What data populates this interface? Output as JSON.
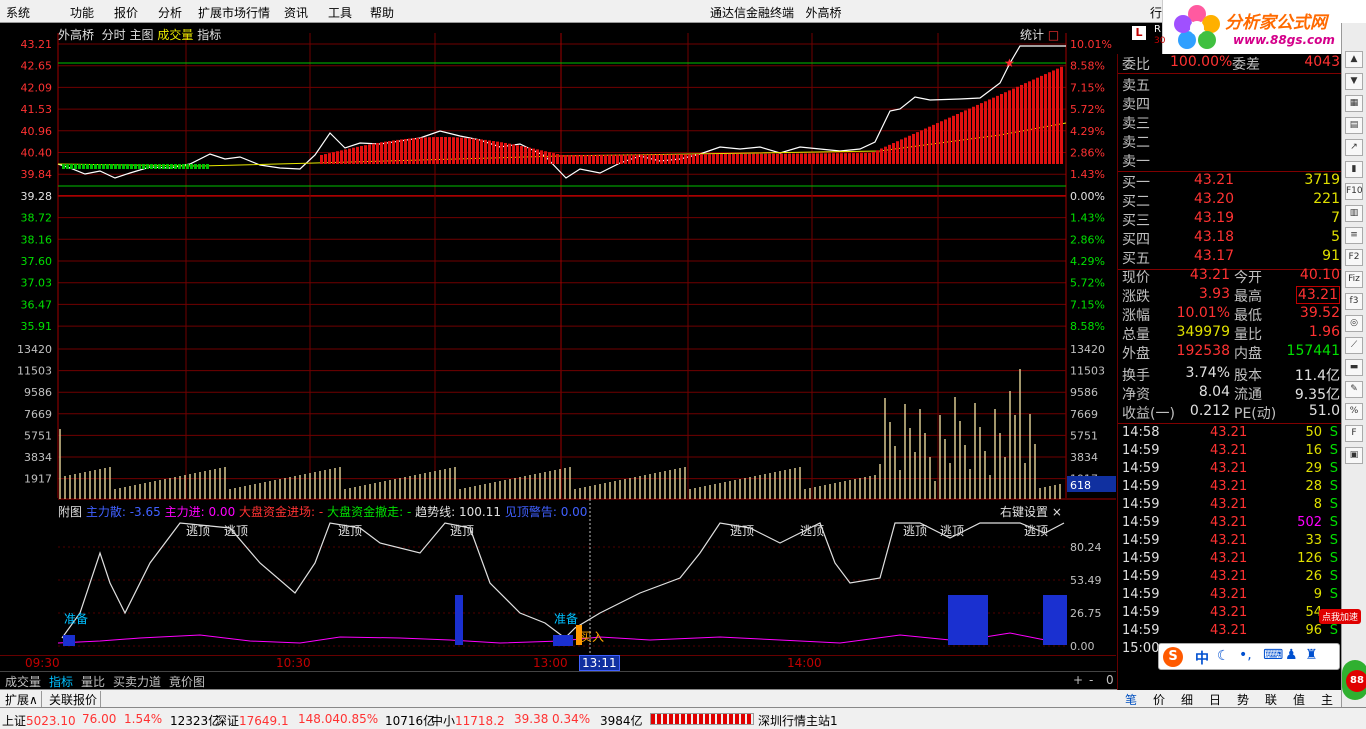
{
  "menu": {
    "items": [
      "系统",
      "功能",
      "报价",
      "分析",
      "扩展市场行情",
      "资讯",
      "工具",
      "帮助"
    ],
    "title": "通达信金融终端",
    "stock": "外高桥",
    "right_cut": "行"
  },
  "logo": {
    "line1": "分析家公式网",
    "line2": "www.88gs.com"
  },
  "chart_header": {
    "stock": "外高桥",
    "labels": [
      "分时",
      "主图",
      "成交量",
      "指标"
    ],
    "stat": "统计"
  },
  "price_axis": {
    "left": [
      "43.21",
      "42.65",
      "42.09",
      "41.53",
      "40.96",
      "40.40",
      "39.84",
      "39.28",
      "38.72",
      "38.16",
      "37.60",
      "37.03",
      "36.47",
      "35.91"
    ],
    "right": [
      "10.01%",
      "8.58%",
      "7.15%",
      "5.72%",
      "4.29%",
      "2.86%",
      "1.43%",
      "0.00%",
      "1.43%",
      "2.86%",
      "4.29%",
      "5.72%",
      "7.15%",
      "8.58%"
    ]
  },
  "vol_axis": {
    "labels": [
      "13420",
      "11503",
      "9586",
      "7669",
      "5751",
      "3834",
      "1917"
    ],
    "badge": "618"
  },
  "indicator": {
    "title": "附图",
    "legend": [
      {
        "text": "主力散",
        "value": "-3.65",
        "color": "#4060ff"
      },
      {
        "text": "主力进",
        "value": "0.00",
        "color": "#ff00ff"
      },
      {
        "text": "大盘资金进场",
        "value": "-",
        "color": "#ff3232"
      },
      {
        "text": "大盘资金撤走",
        "value": "-",
        "color": "#00e000"
      },
      {
        "text": "趋势线",
        "value": "100.11",
        "color": "#e0e0e0"
      },
      {
        "text": "见顶警告",
        "value": "0.00",
        "color": "#4060ff"
      }
    ],
    "setting": "右键设置",
    "close": "×",
    "axis": [
      "80.24",
      "53.49",
      "26.75",
      "0.00"
    ],
    "tags": {
      "top": "逃顶",
      "ready": "准备",
      "buy": "买入"
    }
  },
  "time_axis": {
    "labels": [
      "09:30",
      "10:30",
      "13:00",
      "13:11",
      "14:00"
    ]
  },
  "quote_panel": {
    "top": {
      "L": "L",
      "R": "R",
      "n": "30"
    },
    "ratio": {
      "label": "委比",
      "value": "100.00%",
      "label2": "委差",
      "value2": "4043"
    },
    "sells": [
      {
        "label": "卖五"
      },
      {
        "label": "卖四"
      },
      {
        "label": "卖三"
      },
      {
        "label": "卖二"
      },
      {
        "label": "卖一"
      }
    ],
    "buys": [
      {
        "label": "买一",
        "price": "43.21",
        "vol": "3719"
      },
      {
        "label": "买二",
        "price": "43.20",
        "vol": "221"
      },
      {
        "label": "买三",
        "price": "43.19",
        "vol": "7"
      },
      {
        "label": "买四",
        "price": "43.18",
        "vol": "5"
      },
      {
        "label": "买五",
        "price": "43.17",
        "vol": "91"
      }
    ],
    "stats": [
      {
        "l1": "现价",
        "v1": "43.21",
        "l2": "今开",
        "v2": "40.10"
      },
      {
        "l1": "涨跌",
        "v1": "3.93",
        "l2": "最高",
        "v2": "43.21"
      },
      {
        "l1": "涨幅",
        "v1": "10.01%",
        "l2": "最低",
        "v2": "39.52"
      },
      {
        "l1": "总量",
        "v1": "349979",
        "l2": "量比",
        "v2": "1.96"
      },
      {
        "l1": "外盘",
        "v1": "192538",
        "l2": "内盘",
        "v2": "157441"
      },
      {
        "l1": "换手",
        "v1": "3.74%",
        "l2": "股本",
        "v2": "11.4亿"
      },
      {
        "l1": "净资",
        "v1": "8.04",
        "l2": "流通",
        "v2": "9.35亿"
      },
      {
        "l1": "收益(一)",
        "v1": "0.212",
        "l2": "PE(动)",
        "v2": "51.0"
      }
    ],
    "ticks": [
      {
        "t": "14:58",
        "p": "43.21",
        "v": "50",
        "s": "S"
      },
      {
        "t": "14:59",
        "p": "43.21",
        "v": "16",
        "s": "S"
      },
      {
        "t": "14:59",
        "p": "43.21",
        "v": "29",
        "s": "S"
      },
      {
        "t": "14:59",
        "p": "43.21",
        "v": "28",
        "s": "S"
      },
      {
        "t": "14:59",
        "p": "43.21",
        "v": "8",
        "s": "S"
      },
      {
        "t": "14:59",
        "p": "43.21",
        "v": "502",
        "s": "S"
      },
      {
        "t": "14:59",
        "p": "43.21",
        "v": "33",
        "s": "S"
      },
      {
        "t": "14:59",
        "p": "43.21",
        "v": "126",
        "s": "S"
      },
      {
        "t": "14:59",
        "p": "43.21",
        "v": "26",
        "s": "S"
      },
      {
        "t": "14:59",
        "p": "43.21",
        "v": "9",
        "s": "S"
      },
      {
        "t": "14:59",
        "p": "43.21",
        "v": "54",
        "s": ""
      },
      {
        "t": "14:59",
        "p": "43.21",
        "v": "96",
        "s": "S"
      },
      {
        "t": "15:00",
        "p": "",
        "v": "",
        "s": ""
      }
    ]
  },
  "tabs1": [
    "成交量",
    "指标",
    "量比",
    "买卖力道",
    "竟价图"
  ],
  "tabs1_right": [
    "+",
    "-",
    "0"
  ],
  "tabs2": [
    "扩展∧",
    "关联报价"
  ],
  "rtabs": [
    "笔",
    "价",
    "细",
    "日",
    "势",
    "联",
    "值",
    "主"
  ],
  "status": {
    "sh_label": "上证",
    "sh": "5023.10",
    "sh_chg": "76.00",
    "sh_pct": "1.54%",
    "sh_amt": "12323亿",
    "sz_label": "深证",
    "sz": "17649.1",
    "sz_chg": "148.04",
    "sz_pct": "0.85%",
    "sz_amt": "10716亿",
    "zx_label": "中小",
    "zx": "11718.2",
    "zx_chg": "39.38",
    "zx_pct": "0.34%",
    "zx_amt": "3984亿",
    "server": "深圳行情主站1"
  },
  "ime": {
    "label": "中",
    "add": "点我加速",
    "badge": "88"
  },
  "sidebar_icons": [
    "up-icon",
    "down-icon",
    "grid-icon",
    "tile-icon",
    "chart-icon",
    "candle-icon",
    "f10-icon",
    "table-icon",
    "list-icon",
    "f2-icon",
    "fiz-icon",
    "f3-icon",
    "circle-icon",
    "line-icon",
    "bar-icon",
    "pen-icon",
    "percent-icon",
    "f-icon",
    "box-icon"
  ],
  "colors": {
    "up": "#ff3232",
    "down": "#00e000",
    "grid": "#800000",
    "axis": "#c00000"
  }
}
